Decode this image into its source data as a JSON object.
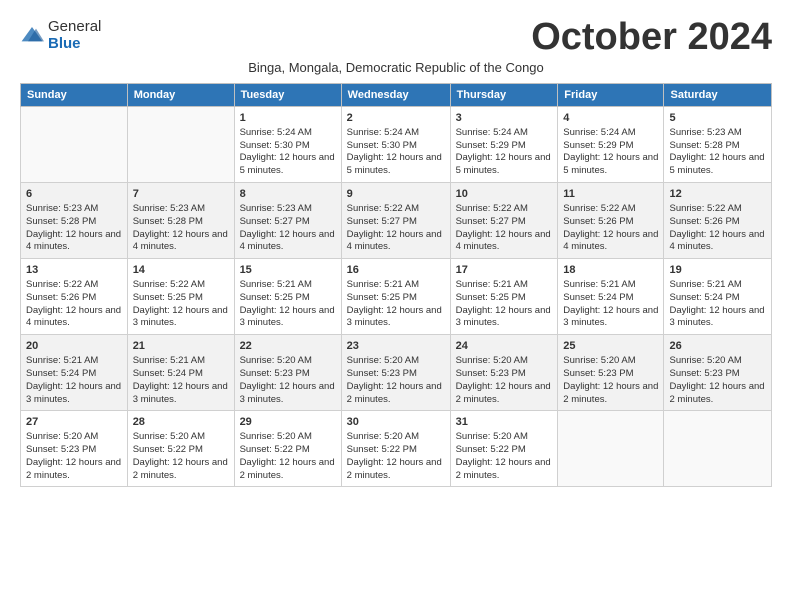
{
  "logo": {
    "general": "General",
    "blue": "Blue"
  },
  "title": "October 2024",
  "subtitle": "Binga, Mongala, Democratic Republic of the Congo",
  "days_of_week": [
    "Sunday",
    "Monday",
    "Tuesday",
    "Wednesday",
    "Thursday",
    "Friday",
    "Saturday"
  ],
  "weeks": [
    [
      {
        "day": "",
        "sunrise": "",
        "sunset": "",
        "daylight": ""
      },
      {
        "day": "",
        "sunrise": "",
        "sunset": "",
        "daylight": ""
      },
      {
        "day": "1",
        "sunrise": "Sunrise: 5:24 AM",
        "sunset": "Sunset: 5:30 PM",
        "daylight": "Daylight: 12 hours and 5 minutes."
      },
      {
        "day": "2",
        "sunrise": "Sunrise: 5:24 AM",
        "sunset": "Sunset: 5:30 PM",
        "daylight": "Daylight: 12 hours and 5 minutes."
      },
      {
        "day": "3",
        "sunrise": "Sunrise: 5:24 AM",
        "sunset": "Sunset: 5:29 PM",
        "daylight": "Daylight: 12 hours and 5 minutes."
      },
      {
        "day": "4",
        "sunrise": "Sunrise: 5:24 AM",
        "sunset": "Sunset: 5:29 PM",
        "daylight": "Daylight: 12 hours and 5 minutes."
      },
      {
        "day": "5",
        "sunrise": "Sunrise: 5:23 AM",
        "sunset": "Sunset: 5:28 PM",
        "daylight": "Daylight: 12 hours and 5 minutes."
      }
    ],
    [
      {
        "day": "6",
        "sunrise": "Sunrise: 5:23 AM",
        "sunset": "Sunset: 5:28 PM",
        "daylight": "Daylight: 12 hours and 4 minutes."
      },
      {
        "day": "7",
        "sunrise": "Sunrise: 5:23 AM",
        "sunset": "Sunset: 5:28 PM",
        "daylight": "Daylight: 12 hours and 4 minutes."
      },
      {
        "day": "8",
        "sunrise": "Sunrise: 5:23 AM",
        "sunset": "Sunset: 5:27 PM",
        "daylight": "Daylight: 12 hours and 4 minutes."
      },
      {
        "day": "9",
        "sunrise": "Sunrise: 5:22 AM",
        "sunset": "Sunset: 5:27 PM",
        "daylight": "Daylight: 12 hours and 4 minutes."
      },
      {
        "day": "10",
        "sunrise": "Sunrise: 5:22 AM",
        "sunset": "Sunset: 5:27 PM",
        "daylight": "Daylight: 12 hours and 4 minutes."
      },
      {
        "day": "11",
        "sunrise": "Sunrise: 5:22 AM",
        "sunset": "Sunset: 5:26 PM",
        "daylight": "Daylight: 12 hours and 4 minutes."
      },
      {
        "day": "12",
        "sunrise": "Sunrise: 5:22 AM",
        "sunset": "Sunset: 5:26 PM",
        "daylight": "Daylight: 12 hours and 4 minutes."
      }
    ],
    [
      {
        "day": "13",
        "sunrise": "Sunrise: 5:22 AM",
        "sunset": "Sunset: 5:26 PM",
        "daylight": "Daylight: 12 hours and 4 minutes."
      },
      {
        "day": "14",
        "sunrise": "Sunrise: 5:22 AM",
        "sunset": "Sunset: 5:25 PM",
        "daylight": "Daylight: 12 hours and 3 minutes."
      },
      {
        "day": "15",
        "sunrise": "Sunrise: 5:21 AM",
        "sunset": "Sunset: 5:25 PM",
        "daylight": "Daylight: 12 hours and 3 minutes."
      },
      {
        "day": "16",
        "sunrise": "Sunrise: 5:21 AM",
        "sunset": "Sunset: 5:25 PM",
        "daylight": "Daylight: 12 hours and 3 minutes."
      },
      {
        "day": "17",
        "sunrise": "Sunrise: 5:21 AM",
        "sunset": "Sunset: 5:25 PM",
        "daylight": "Daylight: 12 hours and 3 minutes."
      },
      {
        "day": "18",
        "sunrise": "Sunrise: 5:21 AM",
        "sunset": "Sunset: 5:24 PM",
        "daylight": "Daylight: 12 hours and 3 minutes."
      },
      {
        "day": "19",
        "sunrise": "Sunrise: 5:21 AM",
        "sunset": "Sunset: 5:24 PM",
        "daylight": "Daylight: 12 hours and 3 minutes."
      }
    ],
    [
      {
        "day": "20",
        "sunrise": "Sunrise: 5:21 AM",
        "sunset": "Sunset: 5:24 PM",
        "daylight": "Daylight: 12 hours and 3 minutes."
      },
      {
        "day": "21",
        "sunrise": "Sunrise: 5:21 AM",
        "sunset": "Sunset: 5:24 PM",
        "daylight": "Daylight: 12 hours and 3 minutes."
      },
      {
        "day": "22",
        "sunrise": "Sunrise: 5:20 AM",
        "sunset": "Sunset: 5:23 PM",
        "daylight": "Daylight: 12 hours and 3 minutes."
      },
      {
        "day": "23",
        "sunrise": "Sunrise: 5:20 AM",
        "sunset": "Sunset: 5:23 PM",
        "daylight": "Daylight: 12 hours and 2 minutes."
      },
      {
        "day": "24",
        "sunrise": "Sunrise: 5:20 AM",
        "sunset": "Sunset: 5:23 PM",
        "daylight": "Daylight: 12 hours and 2 minutes."
      },
      {
        "day": "25",
        "sunrise": "Sunrise: 5:20 AM",
        "sunset": "Sunset: 5:23 PM",
        "daylight": "Daylight: 12 hours and 2 minutes."
      },
      {
        "day": "26",
        "sunrise": "Sunrise: 5:20 AM",
        "sunset": "Sunset: 5:23 PM",
        "daylight": "Daylight: 12 hours and 2 minutes."
      }
    ],
    [
      {
        "day": "27",
        "sunrise": "Sunrise: 5:20 AM",
        "sunset": "Sunset: 5:23 PM",
        "daylight": "Daylight: 12 hours and 2 minutes."
      },
      {
        "day": "28",
        "sunrise": "Sunrise: 5:20 AM",
        "sunset": "Sunset: 5:22 PM",
        "daylight": "Daylight: 12 hours and 2 minutes."
      },
      {
        "day": "29",
        "sunrise": "Sunrise: 5:20 AM",
        "sunset": "Sunset: 5:22 PM",
        "daylight": "Daylight: 12 hours and 2 minutes."
      },
      {
        "day": "30",
        "sunrise": "Sunrise: 5:20 AM",
        "sunset": "Sunset: 5:22 PM",
        "daylight": "Daylight: 12 hours and 2 minutes."
      },
      {
        "day": "31",
        "sunrise": "Sunrise: 5:20 AM",
        "sunset": "Sunset: 5:22 PM",
        "daylight": "Daylight: 12 hours and 2 minutes."
      },
      {
        "day": "",
        "sunrise": "",
        "sunset": "",
        "daylight": ""
      },
      {
        "day": "",
        "sunrise": "",
        "sunset": "",
        "daylight": ""
      }
    ]
  ]
}
